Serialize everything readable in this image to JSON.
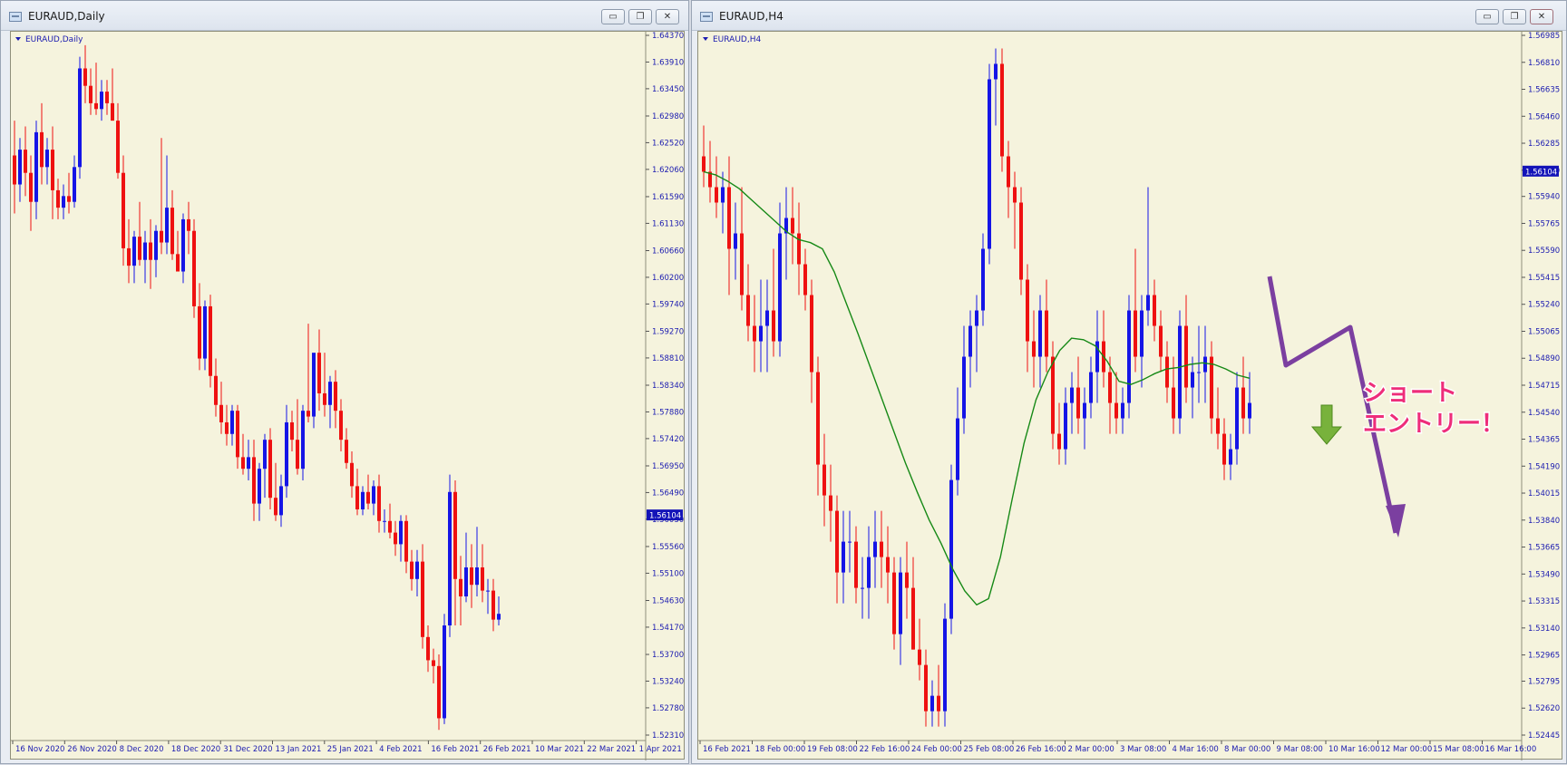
{
  "left_window": {
    "title": "EURAUD,Daily",
    "min_glyph": "▭",
    "max_glyph": "❐",
    "close_glyph": "✕"
  },
  "right_window": {
    "title": "EURAUD,H4",
    "min_glyph": "▭",
    "max_glyph": "❐",
    "close_glyph": "✕"
  },
  "annotation": {
    "line1": "ショート",
    "line2": "エントリー！",
    "text_color": "#ee2d7a",
    "arrow_color": "#7b3fa0",
    "down_arrow_color": "#78b23c"
  },
  "colors": {
    "bull": "#1515e6",
    "bear": "#ee1111",
    "ma": "#168916",
    "axis_text": "#1b1bb0",
    "background": "#f5f3dd",
    "price_tag": "#1313b8"
  },
  "chart_data": [
    {
      "type": "candlestick",
      "title": "EURAUD,Daily",
      "current_price": 1.56104,
      "current_price_label": "1.56104",
      "ylim": [
        1.5231,
        1.6437
      ],
      "y_ticks": [
        "1.64370",
        "1.63910",
        "1.63450",
        "1.62980",
        "1.62520",
        "1.62060",
        "1.61590",
        "1.61130",
        "1.60660",
        "1.60200",
        "1.59740",
        "1.59270",
        "1.58810",
        "1.58340",
        "1.57880",
        "1.57420",
        "1.56950",
        "1.56490",
        "1.56030",
        "1.55560",
        "1.55100",
        "1.54630",
        "1.54170",
        "1.53700",
        "1.53240",
        "1.52780",
        "1.52310"
      ],
      "x_ticks": [
        "16 Nov 2020",
        "26 Nov 2020",
        "8 Dec 2020",
        "18 Dec 2020",
        "31 Dec 2020",
        "13 Jan 2021",
        "25 Jan 2021",
        "4 Feb 2021",
        "16 Feb 2021",
        "26 Feb 2021",
        "10 Mar 2021",
        "22 Mar 2021",
        "1 Apr 2021"
      ],
      "candles": [
        [
          1.623,
          1.629,
          1.613,
          1.618
        ],
        [
          1.618,
          1.626,
          1.615,
          1.624
        ],
        [
          1.624,
          1.628,
          1.616,
          1.62
        ],
        [
          1.62,
          1.623,
          1.61,
          1.615
        ],
        [
          1.615,
          1.629,
          1.612,
          1.627
        ],
        [
          1.627,
          1.632,
          1.618,
          1.621
        ],
        [
          1.621,
          1.626,
          1.618,
          1.624
        ],
        [
          1.624,
          1.628,
          1.612,
          1.617
        ],
        [
          1.617,
          1.619,
          1.612,
          1.614
        ],
        [
          1.614,
          1.618,
          1.612,
          1.616
        ],
        [
          1.616,
          1.62,
          1.613,
          1.615
        ],
        [
          1.615,
          1.623,
          1.614,
          1.621
        ],
        [
          1.621,
          1.64,
          1.619,
          1.638
        ],
        [
          1.638,
          1.642,
          1.632,
          1.635
        ],
        [
          1.635,
          1.638,
          1.63,
          1.632
        ],
        [
          1.632,
          1.639,
          1.63,
          1.631
        ],
        [
          1.631,
          1.636,
          1.629,
          1.634
        ],
        [
          1.634,
          1.636,
          1.63,
          1.632
        ],
        [
          1.632,
          1.638,
          1.629,
          1.629
        ],
        [
          1.629,
          1.632,
          1.619,
          1.62
        ],
        [
          1.62,
          1.623,
          1.604,
          1.607
        ],
        [
          1.607,
          1.612,
          1.601,
          1.604
        ],
        [
          1.604,
          1.61,
          1.601,
          1.609
        ],
        [
          1.609,
          1.615,
          1.604,
          1.605
        ],
        [
          1.605,
          1.61,
          1.601,
          1.608
        ],
        [
          1.608,
          1.612,
          1.6,
          1.605
        ],
        [
          1.605,
          1.611,
          1.602,
          1.61
        ],
        [
          1.61,
          1.626,
          1.606,
          1.608
        ],
        [
          1.608,
          1.623,
          1.606,
          1.614
        ],
        [
          1.614,
          1.617,
          1.605,
          1.606
        ],
        [
          1.606,
          1.61,
          1.603,
          1.603
        ],
        [
          1.603,
          1.613,
          1.601,
          1.612
        ],
        [
          1.612,
          1.615,
          1.606,
          1.61
        ],
        [
          1.61,
          1.612,
          1.595,
          1.597
        ],
        [
          1.597,
          1.601,
          1.586,
          1.588
        ],
        [
          1.588,
          1.598,
          1.586,
          1.597
        ],
        [
          1.597,
          1.599,
          1.583,
          1.585
        ],
        [
          1.585,
          1.588,
          1.578,
          1.58
        ],
        [
          1.58,
          1.584,
          1.575,
          1.577
        ],
        [
          1.577,
          1.58,
          1.573,
          1.575
        ],
        [
          1.575,
          1.58,
          1.573,
          1.579
        ],
        [
          1.579,
          1.58,
          1.569,
          1.571
        ],
        [
          1.571,
          1.575,
          1.568,
          1.569
        ],
        [
          1.569,
          1.574,
          1.567,
          1.571
        ],
        [
          1.571,
          1.574,
          1.56,
          1.563
        ],
        [
          1.563,
          1.57,
          1.56,
          1.569
        ],
        [
          1.569,
          1.575,
          1.564,
          1.574
        ],
        [
          1.574,
          1.576,
          1.562,
          1.564
        ],
        [
          1.564,
          1.57,
          1.56,
          1.561
        ],
        [
          1.561,
          1.568,
          1.559,
          1.566
        ],
        [
          1.566,
          1.58,
          1.564,
          1.577
        ],
        [
          1.577,
          1.579,
          1.572,
          1.574
        ],
        [
          1.574,
          1.581,
          1.568,
          1.569
        ],
        [
          1.569,
          1.58,
          1.567,
          1.579
        ],
        [
          1.579,
          1.594,
          1.577,
          1.578
        ],
        [
          1.578,
          1.587,
          1.576,
          1.589
        ],
        [
          1.589,
          1.593,
          1.579,
          1.582
        ],
        [
          1.582,
          1.589,
          1.578,
          1.58
        ],
        [
          1.58,
          1.585,
          1.576,
          1.584
        ],
        [
          1.584,
          1.586,
          1.576,
          1.579
        ],
        [
          1.579,
          1.581,
          1.572,
          1.574
        ],
        [
          1.574,
          1.576,
          1.569,
          1.57
        ],
        [
          1.57,
          1.572,
          1.564,
          1.566
        ],
        [
          1.566,
          1.569,
          1.561,
          1.562
        ],
        [
          1.562,
          1.566,
          1.561,
          1.565
        ],
        [
          1.565,
          1.568,
          1.562,
          1.563
        ],
        [
          1.563,
          1.567,
          1.561,
          1.566
        ],
        [
          1.566,
          1.568,
          1.558,
          1.56
        ],
        [
          1.56,
          1.562,
          1.558,
          1.56
        ],
        [
          1.56,
          1.563,
          1.557,
          1.558
        ],
        [
          1.558,
          1.56,
          1.554,
          1.556
        ],
        [
          1.556,
          1.561,
          1.553,
          1.56
        ],
        [
          1.56,
          1.561,
          1.551,
          1.553
        ],
        [
          1.553,
          1.555,
          1.548,
          1.55
        ],
        [
          1.55,
          1.555,
          1.547,
          1.553
        ],
        [
          1.553,
          1.556,
          1.538,
          1.54
        ],
        [
          1.54,
          1.542,
          1.534,
          1.536
        ],
        [
          1.536,
          1.538,
          1.532,
          1.535
        ],
        [
          1.535,
          1.537,
          1.524,
          1.526
        ],
        [
          1.526,
          1.544,
          1.525,
          1.542
        ],
        [
          1.542,
          1.568,
          1.54,
          1.565
        ],
        [
          1.565,
          1.567,
          1.542,
          1.55
        ],
        [
          1.55,
          1.554,
          1.542,
          1.547
        ],
        [
          1.547,
          1.558,
          1.546,
          1.552
        ],
        [
          1.552,
          1.556,
          1.545,
          1.549
        ],
        [
          1.549,
          1.559,
          1.547,
          1.552
        ],
        [
          1.552,
          1.556,
          1.546,
          1.548
        ],
        [
          1.548,
          1.55,
          1.544,
          1.548
        ],
        [
          1.548,
          1.55,
          1.541,
          1.543
        ],
        [
          1.543,
          1.547,
          1.542,
          1.544
        ]
      ]
    },
    {
      "type": "candlestick",
      "title": "EURAUD,H4",
      "current_price": 1.56104,
      "current_price_label": "1.56104",
      "ylim": [
        1.52445,
        1.56985
      ],
      "y_ticks": [
        "1.56985",
        "1.56810",
        "1.56635",
        "1.56460",
        "1.56285",
        "1.56110",
        "1.55940",
        "1.55765",
        "1.55590",
        "1.55415",
        "1.55240",
        "1.55065",
        "1.54890",
        "1.54715",
        "1.54540",
        "1.54365",
        "1.54190",
        "1.54015",
        "1.53840",
        "1.53665",
        "1.53490",
        "1.53315",
        "1.53140",
        "1.52965",
        "1.52795",
        "1.52620",
        "1.52445"
      ],
      "x_ticks": [
        "16 Feb 2021",
        "18 Feb 00:00",
        "19 Feb 08:00",
        "22 Feb 16:00",
        "24 Feb 00:00",
        "25 Feb 08:00",
        "26 Feb 16:00",
        "2 Mar 00:00",
        "3 Mar 08:00",
        "4 Mar 16:00",
        "8 Mar 00:00",
        "9 Mar 08:00",
        "10 Mar 16:00",
        "12 Mar 00:00",
        "15 Mar 08:00",
        "16 Mar 16:00"
      ],
      "candles": [
        [
          1.562,
          1.564,
          1.56,
          1.561
        ],
        [
          1.561,
          1.563,
          1.559,
          1.56
        ],
        [
          1.56,
          1.562,
          1.558,
          1.559
        ],
        [
          1.559,
          1.561,
          1.557,
          1.56
        ],
        [
          1.56,
          1.562,
          1.553,
          1.556
        ],
        [
          1.556,
          1.559,
          1.554,
          1.557
        ],
        [
          1.557,
          1.56,
          1.552,
          1.553
        ],
        [
          1.553,
          1.555,
          1.55,
          1.551
        ],
        [
          1.551,
          1.553,
          1.548,
          1.55
        ],
        [
          1.55,
          1.554,
          1.548,
          1.551
        ],
        [
          1.551,
          1.554,
          1.548,
          1.552
        ],
        [
          1.552,
          1.556,
          1.549,
          1.55
        ],
        [
          1.55,
          1.559,
          1.549,
          1.557
        ],
        [
          1.557,
          1.56,
          1.554,
          1.558
        ],
        [
          1.558,
          1.56,
          1.555,
          1.557
        ],
        [
          1.557,
          1.559,
          1.553,
          1.555
        ],
        [
          1.555,
          1.556,
          1.552,
          1.553
        ],
        [
          1.553,
          1.554,
          1.546,
          1.548
        ],
        [
          1.548,
          1.549,
          1.54,
          1.542
        ],
        [
          1.542,
          1.544,
          1.538,
          1.54
        ],
        [
          1.54,
          1.542,
          1.537,
          1.539
        ],
        [
          1.539,
          1.54,
          1.533,
          1.535
        ],
        [
          1.535,
          1.539,
          1.533,
          1.537
        ],
        [
          1.537,
          1.539,
          1.535,
          1.537
        ],
        [
          1.537,
          1.538,
          1.533,
          1.534
        ],
        [
          1.534,
          1.536,
          1.532,
          1.534
        ],
        [
          1.534,
          1.538,
          1.532,
          1.536
        ],
        [
          1.536,
          1.539,
          1.534,
          1.537
        ],
        [
          1.537,
          1.539,
          1.534,
          1.536
        ],
        [
          1.536,
          1.538,
          1.533,
          1.535
        ],
        [
          1.535,
          1.536,
          1.53,
          1.531
        ],
        [
          1.531,
          1.536,
          1.529,
          1.535
        ],
        [
          1.535,
          1.537,
          1.532,
          1.534
        ],
        [
          1.534,
          1.536,
          1.53,
          1.53
        ],
        [
          1.53,
          1.532,
          1.528,
          1.529
        ],
        [
          1.529,
          1.53,
          1.525,
          1.526
        ],
        [
          1.526,
          1.528,
          1.525,
          1.527
        ],
        [
          1.527,
          1.529,
          1.525,
          1.526
        ],
        [
          1.526,
          1.533,
          1.525,
          1.532
        ],
        [
          1.532,
          1.542,
          1.531,
          1.541
        ],
        [
          1.541,
          1.547,
          1.54,
          1.545
        ],
        [
          1.545,
          1.551,
          1.544,
          1.549
        ],
        [
          1.549,
          1.552,
          1.547,
          1.551
        ],
        [
          1.551,
          1.553,
          1.548,
          1.552
        ],
        [
          1.552,
          1.557,
          1.551,
          1.556
        ],
        [
          1.556,
          1.568,
          1.555,
          1.567
        ],
        [
          1.567,
          1.569,
          1.564,
          1.568
        ],
        [
          1.568,
          1.569,
          1.561,
          1.562
        ],
        [
          1.562,
          1.563,
          1.558,
          1.56
        ],
        [
          1.56,
          1.561,
          1.556,
          1.559
        ],
        [
          1.559,
          1.56,
          1.553,
          1.554
        ],
        [
          1.554,
          1.555,
          1.548,
          1.55
        ],
        [
          1.55,
          1.552,
          1.547,
          1.549
        ],
        [
          1.549,
          1.553,
          1.547,
          1.552
        ],
        [
          1.552,
          1.554,
          1.548,
          1.549
        ],
        [
          1.549,
          1.55,
          1.543,
          1.544
        ],
        [
          1.544,
          1.546,
          1.542,
          1.543
        ],
        [
          1.543,
          1.547,
          1.542,
          1.546
        ],
        [
          1.546,
          1.548,
          1.544,
          1.547
        ],
        [
          1.547,
          1.549,
          1.544,
          1.545
        ],
        [
          1.545,
          1.547,
          1.543,
          1.546
        ],
        [
          1.546,
          1.549,
          1.545,
          1.548
        ],
        [
          1.548,
          1.552,
          1.546,
          1.55
        ],
        [
          1.55,
          1.552,
          1.547,
          1.548
        ],
        [
          1.548,
          1.549,
          1.544,
          1.546
        ],
        [
          1.546,
          1.548,
          1.544,
          1.545
        ],
        [
          1.545,
          1.547,
          1.544,
          1.546
        ],
        [
          1.546,
          1.553,
          1.545,
          1.552
        ],
        [
          1.552,
          1.556,
          1.548,
          1.549
        ],
        [
          1.549,
          1.553,
          1.547,
          1.552
        ],
        [
          1.552,
          1.56,
          1.551,
          1.553
        ],
        [
          1.553,
          1.554,
          1.55,
          1.551
        ],
        [
          1.551,
          1.552,
          1.548,
          1.549
        ],
        [
          1.549,
          1.55,
          1.546,
          1.547
        ],
        [
          1.547,
          1.549,
          1.544,
          1.545
        ],
        [
          1.545,
          1.552,
          1.544,
          1.551
        ],
        [
          1.551,
          1.553,
          1.546,
          1.547
        ],
        [
          1.547,
          1.549,
          1.545,
          1.548
        ],
        [
          1.548,
          1.551,
          1.546,
          1.548
        ],
        [
          1.548,
          1.551,
          1.546,
          1.549
        ],
        [
          1.549,
          1.55,
          1.544,
          1.545
        ],
        [
          1.545,
          1.547,
          1.543,
          1.544
        ],
        [
          1.544,
          1.545,
          1.541,
          1.542
        ],
        [
          1.542,
          1.544,
          1.541,
          1.543
        ],
        [
          1.543,
          1.548,
          1.542,
          1.547
        ],
        [
          1.547,
          1.549,
          1.544,
          1.545
        ],
        [
          1.545,
          1.548,
          1.544,
          1.546
        ]
      ],
      "ma": [
        1.561,
        1.5608,
        1.5604,
        1.5599,
        1.5592,
        1.5585,
        1.5578,
        1.5571,
        1.5566,
        1.5564,
        1.556,
        1.5545,
        1.5525,
        1.5505,
        1.5484,
        1.5463,
        1.5442,
        1.5421,
        1.5402,
        1.5384,
        1.5369,
        1.5352,
        1.5338,
        1.5329,
        1.5333,
        1.536,
        1.5398,
        1.5434,
        1.5462,
        1.548,
        1.5494,
        1.5502,
        1.5501,
        1.5497,
        1.5487,
        1.5474,
        1.5472,
        1.5475,
        1.5479,
        1.5482,
        1.5483,
        1.5485,
        1.5486,
        1.5485,
        1.5482,
        1.5478,
        1.5476
      ]
    }
  ]
}
